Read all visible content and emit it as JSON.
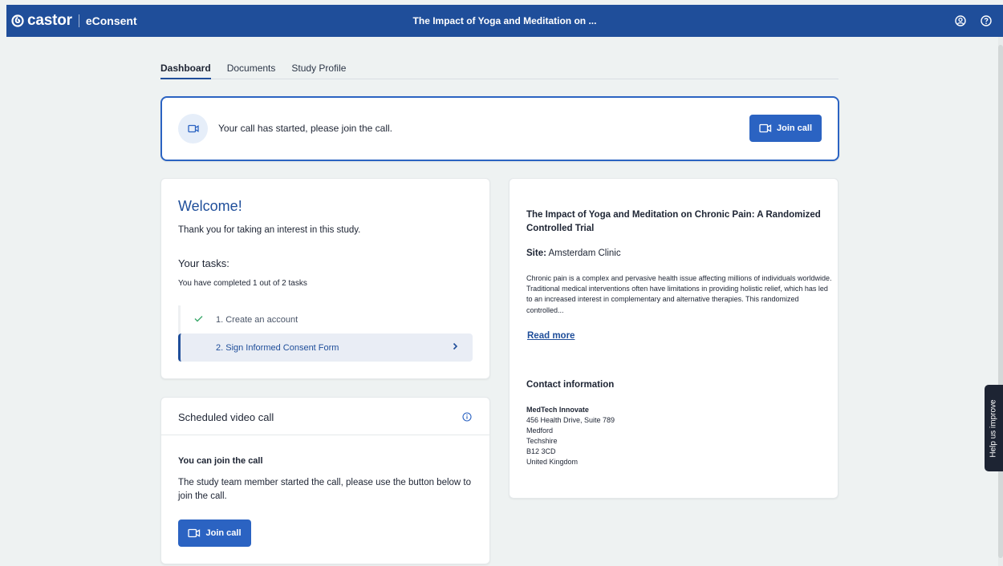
{
  "app": {
    "brand": "castor",
    "product": "eConsent",
    "title": "The Impact of Yoga and Meditation on ...",
    "icons": [
      "user-circle-icon",
      "help-circle-icon"
    ]
  },
  "tabs": [
    {
      "label": "Dashboard",
      "active": true
    },
    {
      "label": "Documents",
      "active": false
    },
    {
      "label": "Study Profile",
      "active": false
    }
  ],
  "banner": {
    "message": "Your call has started, please join the call.",
    "button": "Join call"
  },
  "welcome": {
    "title": "Welcome!",
    "thanks": "Thank you for taking an interest in this study.",
    "tasks_title": "Your tasks:",
    "progress": "You have completed 1 out of 2 tasks",
    "tasks": [
      {
        "label": "1. Create an account",
        "done": true
      },
      {
        "label": "2. Sign Informed Consent Form",
        "done": false
      }
    ]
  },
  "video_call": {
    "title": "Scheduled video call",
    "subtitle": "You can join the call",
    "description": "The study team member started the call, please use the button below to join the call.",
    "button": "Join call"
  },
  "study": {
    "title": "The Impact of Yoga and Meditation on Chronic Pain: A Randomized Controlled Trial",
    "site_label": "Site:",
    "site_value": "Amsterdam Clinic",
    "description": "Chronic pain is a complex and pervasive health issue affecting millions of individuals worldwide. Traditional medical interventions often have limitations in providing holistic relief, which has led to an increased interest in complementary and alternative therapies. This randomized controlled...",
    "read_more": "Read more",
    "contact_title": "Contact information",
    "contact": {
      "org": "MedTech Innovate",
      "line1": "456 Health Drive, Suite 789",
      "line2": "Medford",
      "line3": "Techshire",
      "line4": "B12 3CD",
      "line5": "United Kingdom"
    }
  },
  "feedback_tab": "Help us improve",
  "colors": {
    "primary": "#1f4e9a",
    "button": "#2b63c2",
    "success": "#3aa86a",
    "background": "#eef2f2"
  }
}
